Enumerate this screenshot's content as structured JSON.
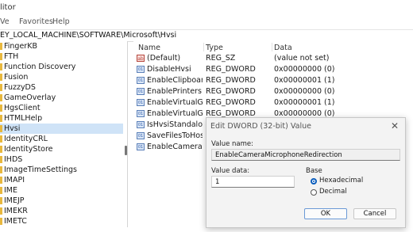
{
  "window": {
    "title": "litor"
  },
  "menu": [
    "Ve",
    "Favorites",
    "Help"
  ],
  "address": "EY_LOCAL_MACHINE\\SOFTWARE\\Microsoft\\Hvsi",
  "tree": {
    "items": [
      {
        "label": "FingerKB"
      },
      {
        "label": "FTH"
      },
      {
        "label": "Function Discovery"
      },
      {
        "label": "Fusion"
      },
      {
        "label": "FuzzyDS"
      },
      {
        "label": "GameOverlay"
      },
      {
        "label": "HgsClient"
      },
      {
        "label": "HTMLHelp"
      },
      {
        "label": "Hvsi",
        "selected": true
      },
      {
        "label": "IdentityCRL"
      },
      {
        "label": "IdentityStore"
      },
      {
        "label": "IHDS"
      },
      {
        "label": "ImageTimeSettings"
      },
      {
        "label": "IMAPI"
      },
      {
        "label": "IME"
      },
      {
        "label": "IMEJP"
      },
      {
        "label": "IMEKR"
      },
      {
        "label": "IMETC"
      }
    ]
  },
  "values": {
    "headers": {
      "name": "Name",
      "type": "Type",
      "data": "Data"
    },
    "rows": [
      {
        "name": "(Default)",
        "type": "REG_SZ",
        "data": "(value not set)",
        "icon": "string-value-icon"
      },
      {
        "name": "DisableHvsi",
        "type": "REG_DWORD",
        "data": "0x00000000 (0)",
        "icon": "binary-value-icon"
      },
      {
        "name": "EnableClipboard",
        "type": "REG_DWORD",
        "data": "0x00000001 (1)",
        "icon": "binary-value-icon"
      },
      {
        "name": "EnablePrinters",
        "type": "REG_DWORD",
        "data": "0x00000000 (0)",
        "icon": "binary-value-icon"
      },
      {
        "name": "EnableVirtualGPU",
        "type": "REG_DWORD",
        "data": "0x00000001 (1)",
        "icon": "binary-value-icon"
      },
      {
        "name": "EnableVirtualGPU",
        "type": "REG_DWORD",
        "data": "0x00000000 (0)",
        "icon": "binary-value-icon"
      },
      {
        "name": "IsHvsiStandalone...",
        "type": "",
        "data": "",
        "icon": "binary-value-icon"
      },
      {
        "name": "SaveFilesToHostI...",
        "type": "",
        "data": "",
        "icon": "binary-value-icon"
      },
      {
        "name": "EnableCameraMi...",
        "type": "",
        "data": "",
        "icon": "binary-value-icon"
      }
    ]
  },
  "dialog": {
    "title": "Edit DWORD (32-bit) Value",
    "value_name_label": "Value name:",
    "value_name": "EnableCameraMicrophoneRedirection",
    "value_data_label": "Value data:",
    "value_data": "1",
    "base_label": "Base",
    "base_options": [
      {
        "label": "Hexadecimal",
        "selected": true
      },
      {
        "label": "Decimal",
        "selected": false
      }
    ],
    "ok_label": "OK",
    "cancel_label": "Cancel",
    "close_glyph": "✕"
  },
  "colors": {
    "folder": "#e8b83e",
    "selection": "#cfe3f7",
    "accent": "#0a5dbd"
  }
}
